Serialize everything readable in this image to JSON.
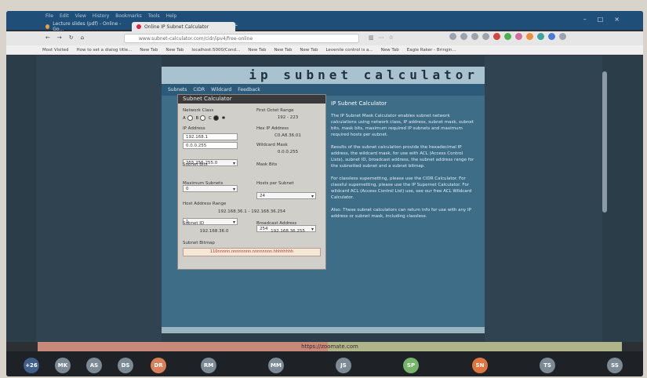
{
  "browser": {
    "menu": [
      "File",
      "Edit",
      "View",
      "History",
      "Bookmarks",
      "Tools",
      "Help"
    ],
    "tabs": [
      {
        "label": "Lecture slides (pdf) - Online - Go..."
      },
      {
        "label": "Online IP Subnet Calculator"
      }
    ],
    "url": "www.subnet-calculator.com/cidr/ipv4/free-online",
    "bookmarks": [
      "Most Visited",
      "How to set a dialog title...",
      "New Tab",
      "New Tab",
      "localhost:5000/Cond...",
      "New Tab",
      "New Tab",
      "New Tab",
      "Levenile control is a...",
      "New Tab",
      "Eagle Raker - Bringin..."
    ]
  },
  "site": {
    "banner": "ip subnet calculator",
    "nav": [
      "Subnets",
      "CIDR",
      "Wildcard",
      "Feedback"
    ]
  },
  "calculator": {
    "title": "Subnet Calculator",
    "network_class_label": "Network Class",
    "network_class_options": [
      "A",
      "B",
      "C",
      "✱"
    ],
    "first_octet_range_label": "First Octet Range",
    "first_octet_range_value": "192 - 223",
    "ip_address_label": "IP Address",
    "ip_address_value": "192.168.1",
    "hex_ip_label": "Hex IP Address",
    "hex_ip_value": "C0.A8.36.01",
    "wildcard_value": "0.0.0.255",
    "wildcard_mask_label": "Wildcard Mask",
    "subnet_mask_value": "255.255.255.0",
    "wildcard_out_value": "0.0.0.255",
    "subnet_bits_label": "Subnet Bits",
    "subnet_bits_value": "0",
    "mask_bits_label": "Mask Bits",
    "mask_bits_value": "24",
    "max_subnets_label": "Maximum Subnets",
    "max_subnets_value": "1",
    "hosts_per_subnet_label": "Hosts per Subnet",
    "hosts_per_subnet_value": "254",
    "host_range_label": "Host Address Range",
    "host_range_value": "192.168.36.1 - 192.168.36.254",
    "subnet_id_label": "Subnet ID",
    "subnet_id_value": "192.168.36.0",
    "broadcast_label": "Broadcast Address",
    "broadcast_value": "192.168.36.255",
    "bitmap_label": "Subnet Bitmap",
    "bitmap_value": "110nnnnn.nnnnnnnn.nnnnnnnn.hhhhhhhh"
  },
  "info": {
    "heading": "IP Subnet Calculator",
    "p1": "The IP Subnet Mask Calculator enables subnet network calculations using network class, IP address, subnet mask, subnet bits, mask bits, maximum required IP subnets and maximum required hosts per subnet.",
    "p2": "Results of the subnet calculation provide the hexadecimal IP address, the wildcard mask, for use with ACL (Access Control Lists), subnet ID, broadcast address, the subnet address range for the subnetted subnet and a subnet bitmap.",
    "p3": "For classless supernetting, please use the CIDR Calculator. For classful supernetting, please use the IP Supernet Calculator. For wildcard ACL (Access Control List) use, see our free ACL Wildcard Calculator.",
    "p4": "Also: These subnet calculators can return info for use with any IP address or subnet mask, including classless."
  },
  "bottom_url": "https://zoomate.com",
  "participants": [
    {
      "initials": "+26",
      "color": "#3f5f8a"
    },
    {
      "initials": "MK",
      "color": "#7c8a96"
    },
    {
      "initials": "AS",
      "color": "#7c8a96"
    },
    {
      "initials": "DS",
      "color": "#7c8a96"
    },
    {
      "initials": "DR",
      "color": "#d9805a"
    },
    {
      "initials": "RM",
      "color": "#7c8a96"
    },
    {
      "initials": "MM",
      "color": "#7c8a96"
    },
    {
      "initials": "JS",
      "color": "#7c8a96"
    },
    {
      "initials": "SP",
      "color": "#74b56a"
    },
    {
      "initials": "SN",
      "color": "#e0743e"
    },
    {
      "initials": "TS",
      "color": "#7c8a96"
    },
    {
      "initials": "SS",
      "color": "#7c8a96"
    }
  ]
}
